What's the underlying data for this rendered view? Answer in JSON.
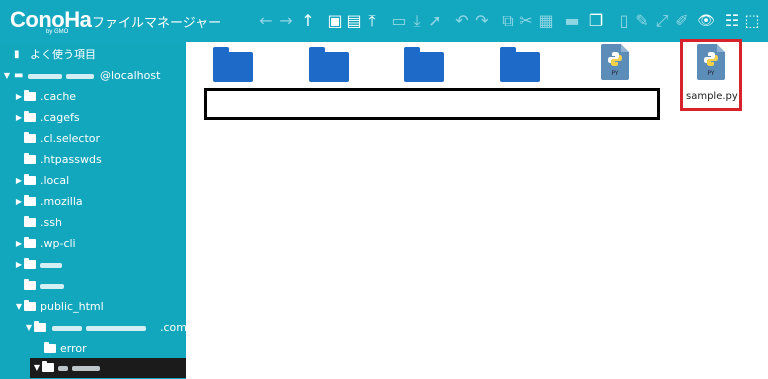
{
  "app": {
    "logo_text": "ConoHa",
    "logo_sub": "by GMO",
    "title": "ファイルマネージャー"
  },
  "toolbar": {
    "icons": [
      {
        "name": "back-arrow-icon",
        "glyph": "←"
      },
      {
        "name": "forward-arrow-icon",
        "glyph": "→"
      },
      {
        "name": "up-arrow-icon",
        "glyph": "↑"
      },
      {
        "name": "new-folder-icon",
        "glyph": "▣"
      },
      {
        "name": "new-file-icon",
        "glyph": "▤"
      },
      {
        "name": "upload-icon",
        "glyph": "⤒"
      },
      {
        "name": "open-folder-icon",
        "glyph": "▭"
      },
      {
        "name": "download-icon",
        "glyph": "⤓"
      },
      {
        "name": "select-cursor-icon",
        "glyph": "➚"
      },
      {
        "name": "undo-icon",
        "glyph": "↶"
      },
      {
        "name": "redo-icon",
        "glyph": "↷"
      },
      {
        "name": "copy-icon",
        "glyph": "⧉"
      },
      {
        "name": "cut-icon",
        "glyph": "✂"
      },
      {
        "name": "paste-icon",
        "glyph": "▦"
      },
      {
        "name": "delete-icon",
        "glyph": "▬"
      },
      {
        "name": "duplicate-icon",
        "glyph": "❐"
      },
      {
        "name": "rename-icon",
        "glyph": "▯"
      },
      {
        "name": "edit-icon",
        "glyph": "✎"
      },
      {
        "name": "resize-icon",
        "glyph": "⤢"
      },
      {
        "name": "preview-eye-icon",
        "glyph": "👁"
      },
      {
        "name": "view-list-icon",
        "glyph": "☷"
      },
      {
        "name": "select-all-icon",
        "glyph": "⬚"
      }
    ]
  },
  "sidebar": {
    "items": [
      {
        "label": "よく使う項目",
        "icon": "bookmark-icon"
      },
      {
        "label": "@localhost",
        "icon": "computer-icon"
      },
      {
        "label": ".cache",
        "icon": "folder-icon"
      },
      {
        "label": ".cagefs",
        "icon": "folder-icon"
      },
      {
        "label": ".cl.selector",
        "icon": "folder-icon"
      },
      {
        "label": ".htpasswds",
        "icon": "folder-icon"
      },
      {
        "label": ".local",
        "icon": "folder-icon"
      },
      {
        "label": ".mozilla",
        "icon": "folder-icon"
      },
      {
        "label": ".ssh",
        "icon": "folder-icon"
      },
      {
        "label": ".wp-cli",
        "icon": "folder-icon"
      },
      {
        "label": "",
        "icon": "folder-icon"
      },
      {
        "label": "",
        "icon": "folder-icon"
      },
      {
        "label": "public_html",
        "icon": "folder-icon"
      },
      {
        "label": ".com",
        "icon": "folder-icon"
      },
      {
        "label": "error",
        "icon": "folder-icon"
      },
      {
        "label": "",
        "icon": "open-folder-icon"
      }
    ]
  },
  "files": {
    "items": [
      {
        "type": "folder"
      },
      {
        "type": "folder"
      },
      {
        "type": "folder"
      },
      {
        "type": "folder"
      },
      {
        "type": "python",
        "ext": "PY"
      },
      {
        "type": "python",
        "ext": "PY",
        "label": "sample.py"
      }
    ]
  },
  "colors": {
    "header": "#14a8c0",
    "sidebar": "#13a7be",
    "folder": "#1e6ac8",
    "highlight_red": "#d5222b",
    "selected_row": "#1b1b1b"
  }
}
